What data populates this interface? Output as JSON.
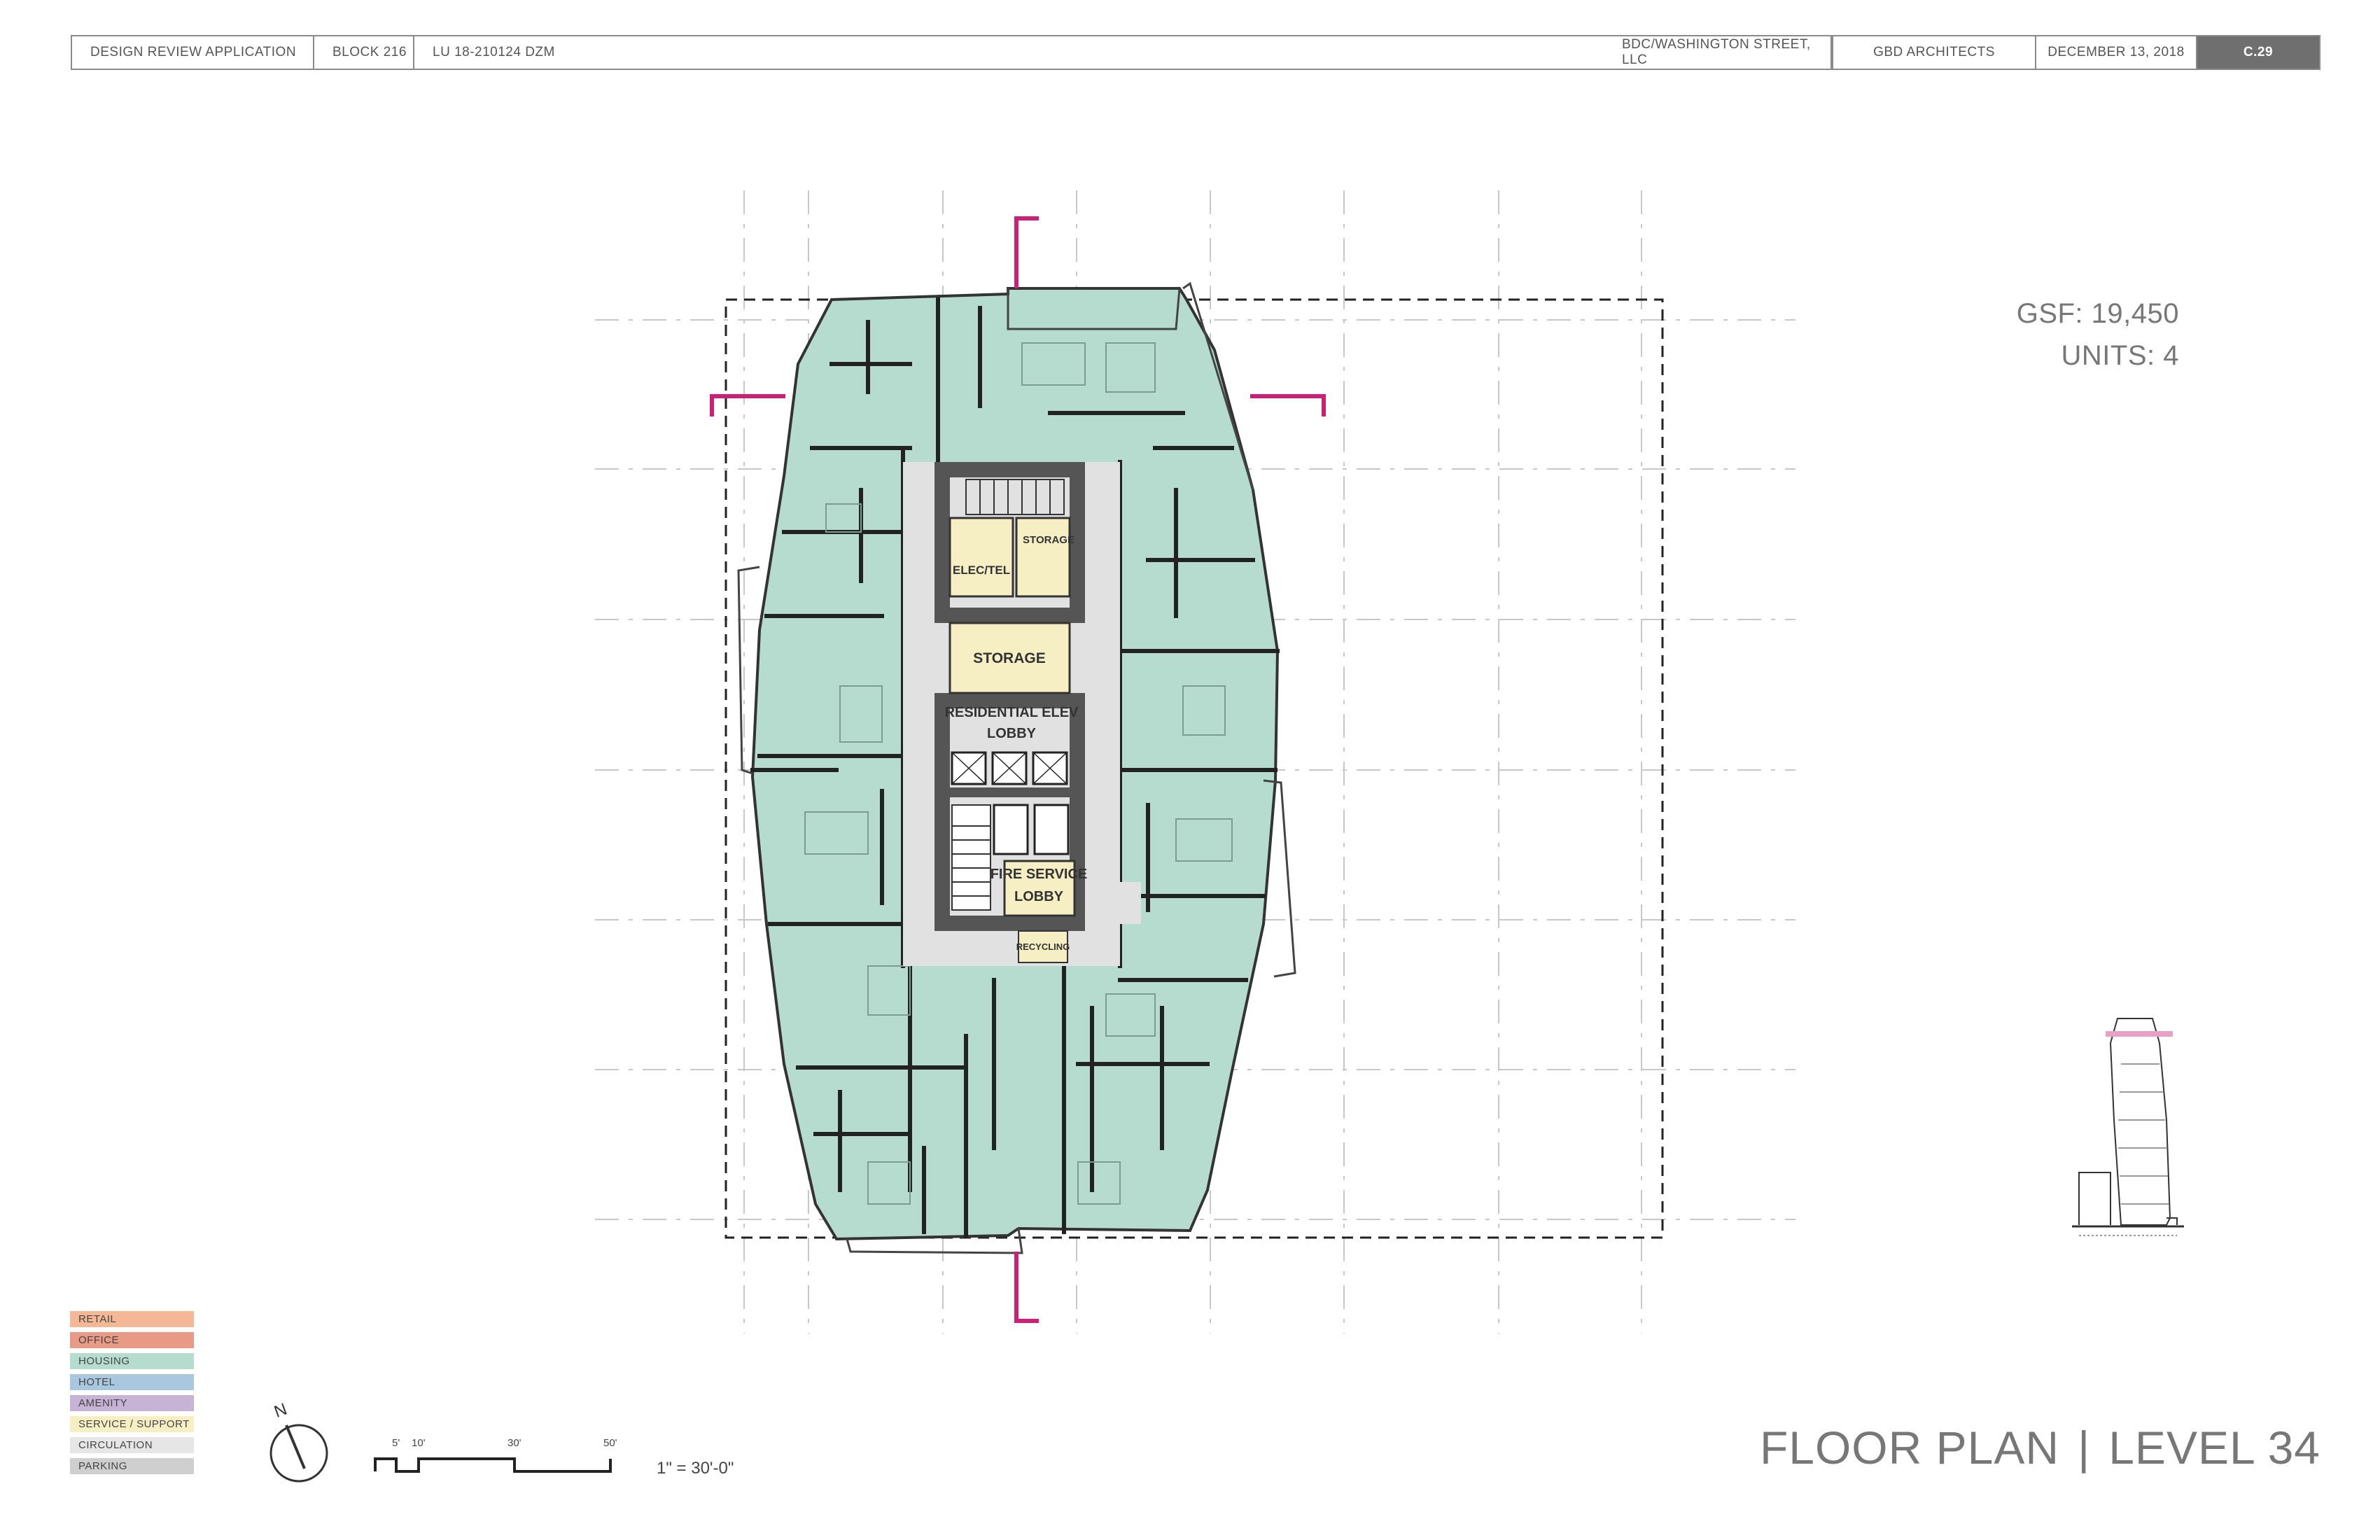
{
  "title_block": {
    "application": "DESIGN REVIEW APPLICATION",
    "block": "BLOCK 216",
    "case_number": "LU 18-210124 DZM",
    "owner": "BDC/WASHINGTON STREET, LLC",
    "architect": "GBD ARCHITECTS",
    "date": "DECEMBER 13,  2018",
    "sheet": "C.29"
  },
  "stats": {
    "gsf": "GSF:  19,450",
    "units": "UNITS:  4"
  },
  "rooms": {
    "elec_tel": "ELEC/TEL",
    "storage_small": "STORAGE",
    "storage_large": "STORAGE",
    "residential_lobby_line1": "RESIDENTIAL ELEV",
    "residential_lobby_line2": "LOBBY",
    "fire_lobby_line1": "FIRE SERVICE",
    "fire_lobby_line2": "LOBBY",
    "recycling": "RECYCLING"
  },
  "legend": [
    {
      "label": "RETAIL",
      "color": "#f4b896"
    },
    {
      "label": "OFFICE",
      "color": "#e99a86"
    },
    {
      "label": "HOUSING",
      "color": "#b5dccf"
    },
    {
      "label": "HOTEL",
      "color": "#a9c8df"
    },
    {
      "label": "AMENITY",
      "color": "#c7b3d6"
    },
    {
      "label": "SERVICE / SUPPORT",
      "color": "#f7efc4"
    },
    {
      "label": "CIRCULATION",
      "color": "#e6e6e6"
    },
    {
      "label": "PARKING",
      "color": "#cfcfcf"
    }
  ],
  "scale": {
    "label": "1\" = 30'-0\"",
    "ticks": [
      "5'",
      "10'",
      "30'",
      "50'"
    ]
  },
  "north_arrow": {
    "letter": "N"
  },
  "sheet_title": {
    "left": "FLOOR PLAN",
    "separator": "|",
    "right": "LEVEL 34"
  },
  "colors": {
    "housing": "#b5dccf",
    "service": "#f7efc4",
    "circulation": "#e1e1e1",
    "core_wall": "#555555",
    "section_marker": "#cc1f78",
    "tower_highlight": "#e8a0c4"
  }
}
